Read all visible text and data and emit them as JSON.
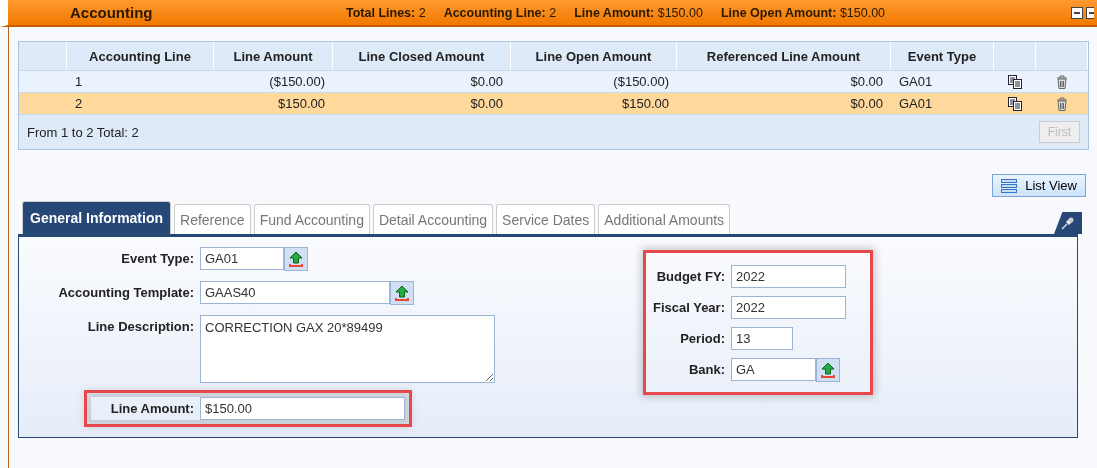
{
  "panel": {
    "title": "Accounting",
    "summary": [
      {
        "label": "Total Lines:",
        "value": "2"
      },
      {
        "label": "Accounting Line:",
        "value": "2"
      },
      {
        "label": "Line Amount:",
        "value": "$150.00"
      },
      {
        "label": "Line Open Amount:",
        "value": "$150.00"
      }
    ]
  },
  "table": {
    "columns": [
      "Accounting Line",
      "Line Amount",
      "Line Closed Amount",
      "Line Open Amount",
      "Referenced Line Amount",
      "Event Type"
    ],
    "rows": [
      {
        "selected": false,
        "cells": [
          "1",
          "($150.00)",
          "$0.00",
          "($150.00)",
          "$0.00",
          "GA01"
        ]
      },
      {
        "selected": true,
        "cells": [
          "2",
          "$150.00",
          "$0.00",
          "$150.00",
          "$0.00",
          "GA01"
        ]
      }
    ],
    "footer": "From 1 to 2 Total: 2",
    "first_button": {
      "label": "First",
      "disabled": true
    }
  },
  "list_view_button": "List View",
  "tabs": [
    {
      "label": "General Information",
      "selected": true
    },
    {
      "label": "Reference",
      "selected": false
    },
    {
      "label": "Fund Accounting",
      "selected": false
    },
    {
      "label": "Detail Accounting",
      "selected": false
    },
    {
      "label": "Service Dates",
      "selected": false
    },
    {
      "label": "Additional Amounts",
      "selected": false
    }
  ],
  "form": {
    "left": [
      {
        "label": "Event Type:",
        "value": "GA01",
        "kind": "lookup",
        "highlighted": false
      },
      {
        "label": "Accounting Template:",
        "value": "GAAS40",
        "kind": "lookup",
        "highlighted": false
      },
      {
        "label": "Line Description:",
        "value": "CORRECTION GAX 20*89499",
        "kind": "textarea",
        "highlighted": false
      },
      {
        "label": "Line Amount:",
        "value": "$150.00",
        "kind": "text",
        "highlighted": true
      }
    ],
    "right": {
      "highlighted": true,
      "fields": [
        {
          "label": "Budget FY:",
          "value": "2022",
          "kind": "text"
        },
        {
          "label": "Fiscal Year:",
          "value": "2022",
          "kind": "text"
        },
        {
          "label": "Period:",
          "value": "13",
          "kind": "text"
        },
        {
          "label": "Bank:",
          "value": "GA",
          "kind": "lookup"
        }
      ]
    }
  }
}
